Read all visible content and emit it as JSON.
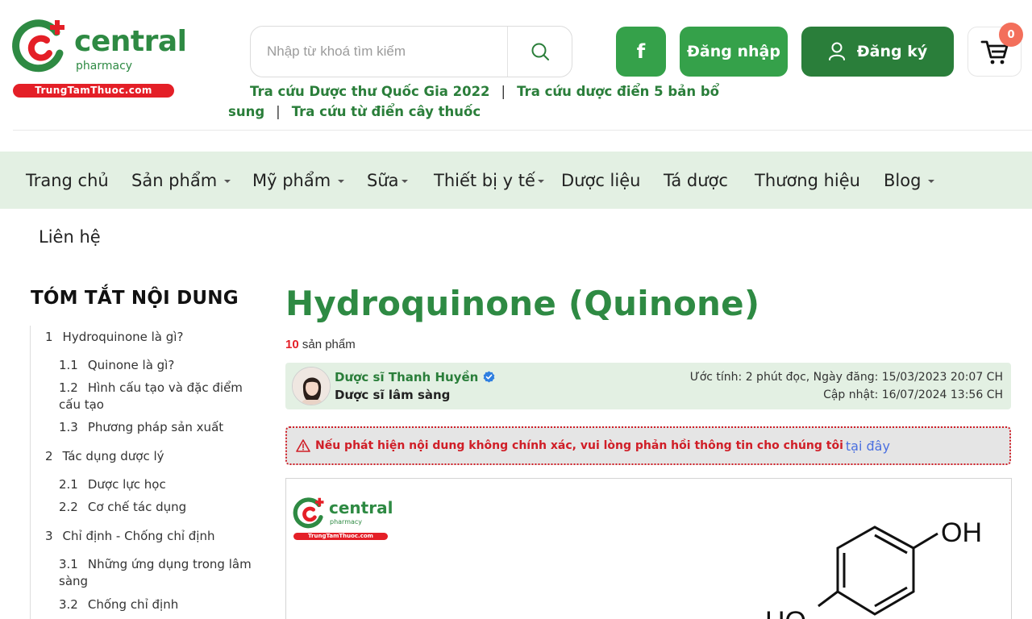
{
  "brand": {
    "name": "central",
    "sub": "pharmacy",
    "domain": "TrungTamThuoc.com",
    "green": "#2e8a43",
    "red": "#e41f27"
  },
  "search": {
    "placeholder": "Nhập từ khoá tìm kiếm",
    "value": ""
  },
  "header_buttons": {
    "facebook_label": "f",
    "login_label": "Đăng nhập",
    "register_label": "Đăng ký"
  },
  "cart": {
    "count": "0"
  },
  "quick_links": [
    "Tra cứu Dược thư Quốc Gia 2022",
    "Tra cứu dược điển 5 bản bổ sung",
    "Tra cứu từ điển cây thuốc"
  ],
  "quick_link_separator": "|",
  "nav": {
    "items": [
      {
        "label": "Trang chủ"
      },
      {
        "label": "Sản phẩm"
      },
      {
        "label": "Mỹ phẩm"
      },
      {
        "label": "Sữa"
      },
      {
        "label": "Thiết bị y tế"
      },
      {
        "label": "Dược liệu"
      },
      {
        "label": "Tá dược"
      },
      {
        "label": "Thương hiệu"
      },
      {
        "label": "Blog"
      },
      {
        "label": "Liên hệ"
      }
    ]
  },
  "toc": {
    "title": "TÓM TẮT NỘI DUNG",
    "items": [
      {
        "num": "1",
        "label": "Hydroquinone là gì?"
      },
      {
        "num": "1.1",
        "label": "Quinone là gì?"
      },
      {
        "num": "1.2",
        "label": "Hình cấu tạo và đặc điểm cấu tạo"
      },
      {
        "num": "1.3",
        "label": "Phương pháp sản xuất"
      },
      {
        "num": "2",
        "label": "Tác dụng dược lý"
      },
      {
        "num": "2.1",
        "label": "Dược lực học"
      },
      {
        "num": "2.2",
        "label": "Cơ chế tác dụng"
      },
      {
        "num": "3",
        "label": "Chỉ định - Chống chỉ định"
      },
      {
        "num": "3.1",
        "label": "Những ứng dụng trong lâm sàng"
      },
      {
        "num": "3.2",
        "label": "Chống chỉ định"
      }
    ]
  },
  "article": {
    "title": "Hydroquinone (Quinone)",
    "product_count": "10",
    "product_count_suffix": "sản phẩm",
    "author_name": "Dược sĩ Thanh Huyền",
    "author_role": "Dược sĩ lâm sàng",
    "meta_line1": "Ước tính: 2 phút đọc, Ngày đăng: 15/03/2023 20:07 CH",
    "meta_line2": "Cập nhật: 16/07/2024 13:56 CH",
    "warning_text": "Nếu phát hiện nội dung không chính xác, vui lòng phản hồi thông tin cho chúng tôi",
    "warning_link": "tại đây",
    "figure_labels": {
      "top_group": "OH",
      "left_group": "HO"
    }
  },
  "icons": {
    "search": "search-icon",
    "facebook": "facebook-icon",
    "user": "user-icon",
    "cart": "cart-icon",
    "verified": "verified-badge-icon",
    "warning": "warning-icon"
  }
}
